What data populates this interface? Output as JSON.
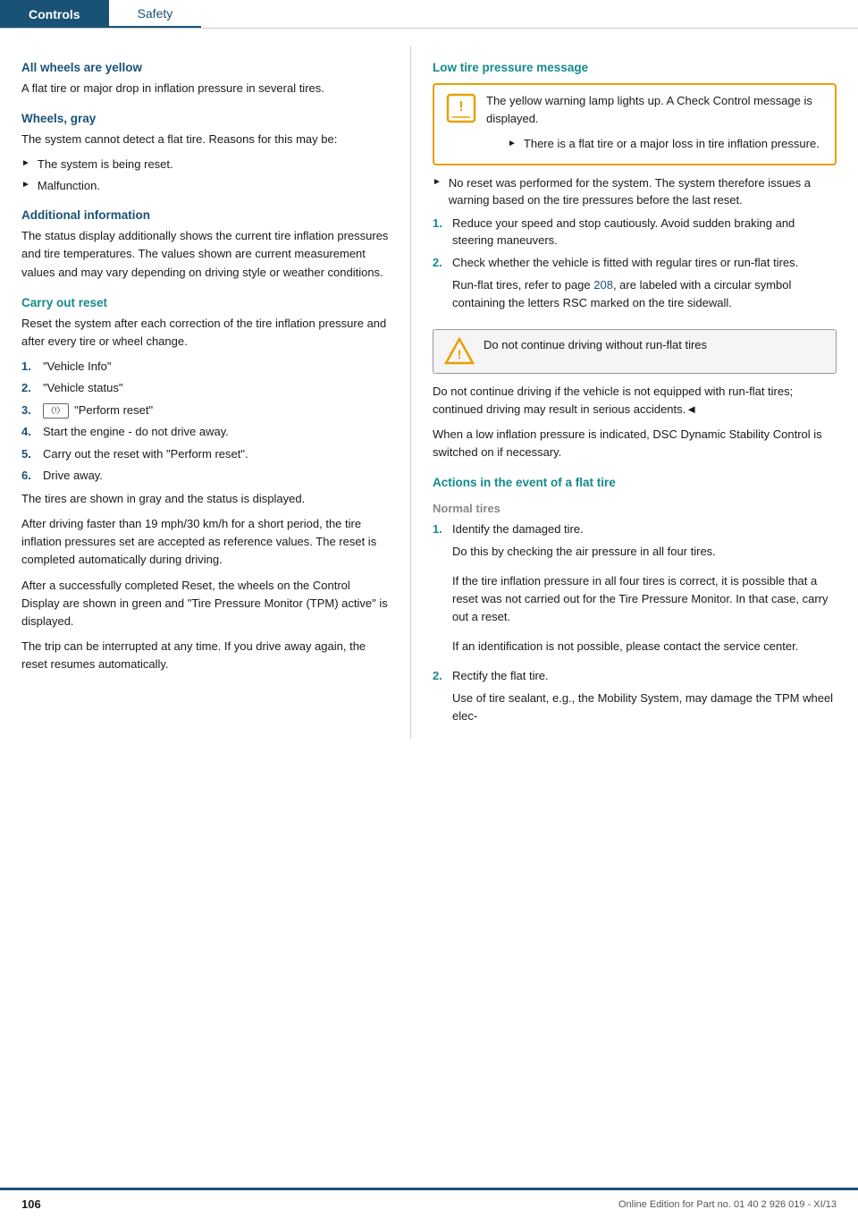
{
  "header": {
    "tab_controls": "Controls",
    "tab_safety": "Safety"
  },
  "left": {
    "section1": {
      "heading": "All wheels are yellow",
      "body": "A flat tire or major drop in inflation pressure in several tires."
    },
    "section2": {
      "heading": "Wheels, gray",
      "body": "The system cannot detect a flat tire. Reasons for this may be:",
      "bullets": [
        "The system is being reset.",
        "Malfunction."
      ]
    },
    "section3": {
      "heading": "Additional information",
      "body": "The status display additionally shows the current tire inflation pressures and tire temperatures. The values shown are current measurement values and may vary depending on driving style or weather conditions."
    },
    "section4": {
      "heading": "Carry out reset",
      "body": "Reset the system after each correction of the tire inflation pressure and after every tire or wheel change.",
      "steps": [
        {
          "num": "1.",
          "text": "\"Vehicle Info\""
        },
        {
          "num": "2.",
          "text": "\"Vehicle status\""
        },
        {
          "num": "3.",
          "text": "\"Perform reset\"",
          "has_icon": true
        },
        {
          "num": "4.",
          "text": "Start the engine - do not drive away."
        },
        {
          "num": "5.",
          "text": "Carry out the reset with \"Perform reset\"."
        },
        {
          "num": "6.",
          "text": "Drive away."
        }
      ],
      "after1": "The tires are shown in gray and the status is displayed.",
      "after2": "After driving faster than 19 mph/30 km/h for a short period, the tire inflation pressures set are accepted as reference values. The reset is completed automatically during driving.",
      "after3": "After a successfully completed Reset, the wheels on the Control Display are shown in green and \"Tire Pressure Monitor (TPM) active\" is displayed.",
      "after4": "The trip can be interrupted at any time. If you drive away again, the reset resumes automatically."
    }
  },
  "right": {
    "section1": {
      "heading": "Low tire pressure message",
      "warning_text1": "The yellow warning lamp lights up. A Check Control message is displayed.",
      "sub_bullet": "There is a flat tire or a major loss in tire inflation pressure.",
      "bullet1": "No reset was performed for the system. The system therefore issues a warning based on the tire pressures before the last reset.",
      "step1_num": "1.",
      "step1_text": "Reduce your speed and stop cautiously. Avoid sudden braking and steering maneuvers.",
      "step2_num": "2.",
      "step2_text": "Check whether the vehicle is fitted with regular tires or run-flat tires.",
      "step2_extra": "Run-flat tires, refer to page ",
      "step2_page": "208",
      "step2_extra2": ", are labeled with a circular symbol containing the letters RSC marked on the tire sidewall."
    },
    "caution": {
      "text": "Do not continue driving without run-flat tires"
    },
    "after_caution": "Do not continue driving if the vehicle is not equipped with run-flat tires; continued driving may result in serious accidents.◄",
    "after_caution2": "When a low inflation pressure is indicated, DSC Dynamic Stability Control is switched on if necessary.",
    "section2": {
      "heading": "Actions in the event of a flat tire"
    },
    "section2a": {
      "subheading": "Normal tires",
      "step1_num": "1.",
      "step1_text": "Identify the damaged tire.",
      "step1_extra1": "Do this by checking the air pressure in all four tires.",
      "step1_extra2": "If the tire inflation pressure in all four tires is correct, it is possible that a reset was not carried out for the Tire Pressure Monitor. In that case, carry out a reset.",
      "step1_extra3": "If an identification is not possible, please contact the service center.",
      "step2_num": "2.",
      "step2_text": "Rectify the flat tire.",
      "step2_extra1": "Use of tire sealant, e.g., the Mobility System, may damage the TPM wheel elec-"
    }
  },
  "footer": {
    "page_num": "106",
    "edition": "Online Edition for Part no. 01 40 2 926 019 - XI/13"
  }
}
